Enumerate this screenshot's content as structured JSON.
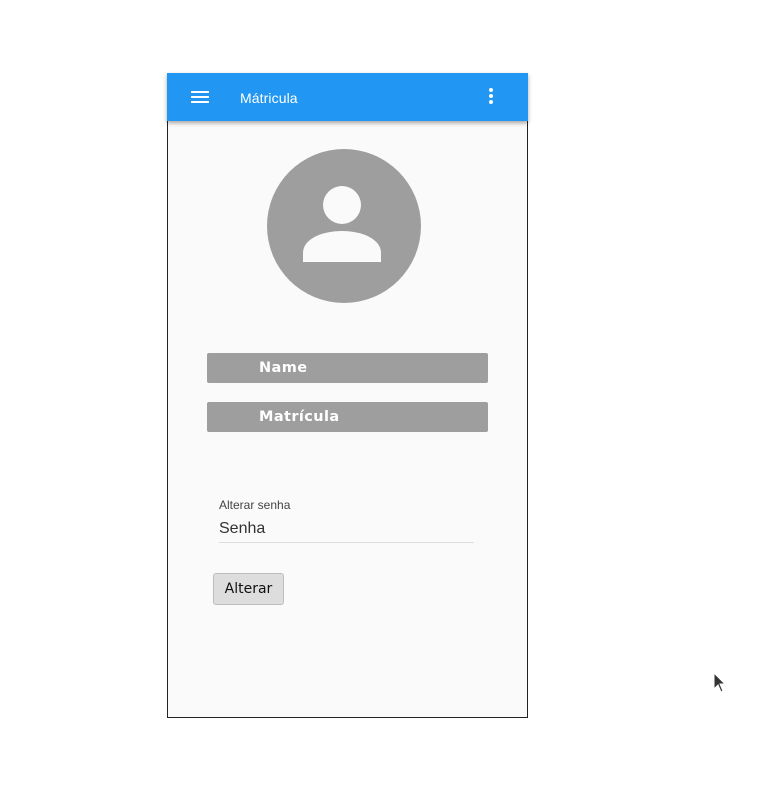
{
  "appbar": {
    "title": "Mátricula",
    "background_color": "#2196f3",
    "menu_icon": "hamburger-menu-icon",
    "more_icon": "more-vert-icon"
  },
  "profile": {
    "avatar_icon": "person-icon",
    "name_label": "Name",
    "matricula_label": "Matrícula"
  },
  "password_form": {
    "label": "Alterar senha",
    "placeholder": "Senha",
    "value": "",
    "submit_label": "Alterar"
  }
}
